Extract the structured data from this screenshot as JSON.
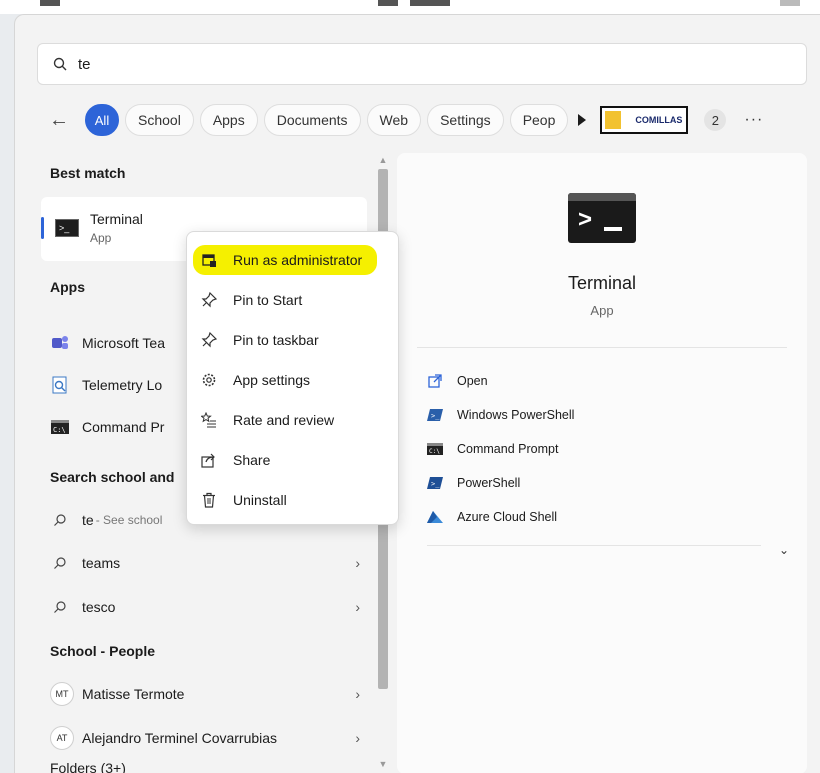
{
  "search": {
    "query": "te"
  },
  "filters": {
    "tabs": [
      "All",
      "School",
      "Apps",
      "Documents",
      "Web",
      "Settings",
      "Peop"
    ],
    "logo_text": "COMILLAS",
    "badge": "2",
    "more": "···"
  },
  "left": {
    "best_match_header": "Best match",
    "best_match": {
      "name": "Terminal",
      "sub": "App"
    },
    "apps_header": "Apps",
    "apps": [
      "Microsoft Tea",
      "Telemetry Lo",
      "Command Pr"
    ],
    "search_header": "Search school and",
    "search_items": [
      {
        "text": "te",
        "sub": "- See school"
      },
      {
        "text": "teams",
        "sub": ""
      },
      {
        "text": "tesco",
        "sub": ""
      }
    ],
    "people_header": "School - People",
    "people": [
      {
        "initials": "MT",
        "name": "Matisse Termote"
      },
      {
        "initials": "AT",
        "name": "Alejandro Terminel Covarrubias"
      }
    ],
    "folders_header": "Folders (3+)"
  },
  "right": {
    "app_name": "Terminal",
    "app_type": "App",
    "actions": [
      "Open",
      "Windows PowerShell",
      "Command Prompt",
      "PowerShell",
      "Azure Cloud Shell"
    ]
  },
  "context_menu": {
    "items": [
      "Run as administrator",
      "Pin to Start",
      "Pin to taskbar",
      "App settings",
      "Rate and review",
      "Share",
      "Uninstall"
    ]
  },
  "colors": {
    "accent": "#2d64d8",
    "highlight": "#f5f000"
  }
}
